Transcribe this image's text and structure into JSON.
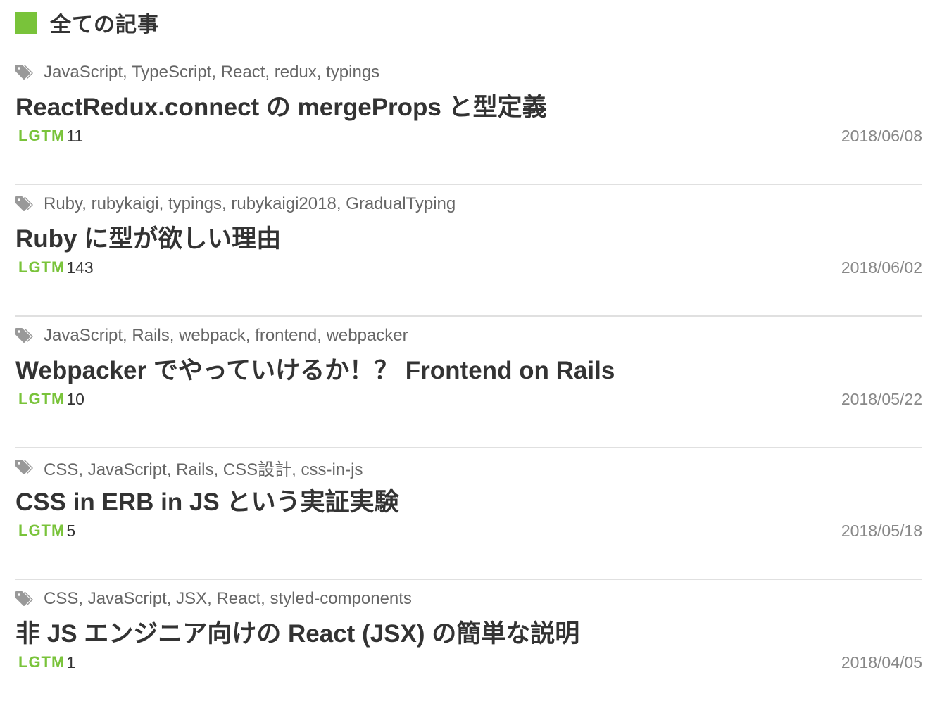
{
  "section": {
    "title": "全ての記事"
  },
  "colors": {
    "accent": "#79c33a",
    "tag_icon": "#999999",
    "divider": "#e0e0e0"
  },
  "icons": {
    "tag": "tags-icon"
  },
  "articles": [
    {
      "tags": [
        "JavaScript",
        "TypeScript",
        "React",
        "redux",
        "typings"
      ],
      "title": "ReactRedux.connect の mergeProps と型定義",
      "lgtm_label": "LGTM",
      "lgtm_count": "11",
      "date": "2018/06/08"
    },
    {
      "tags": [
        "Ruby",
        "rubykaigi",
        "typings",
        "rubykaigi2018",
        "GradualTyping"
      ],
      "title": "Ruby に型が欲しい理由",
      "lgtm_label": "LGTM",
      "lgtm_count": "143",
      "date": "2018/06/02"
    },
    {
      "tags": [
        "JavaScript",
        "Rails",
        "webpack",
        "frontend",
        "webpacker"
      ],
      "title": "Webpacker でやっていけるか！？ Frontend on Rails",
      "lgtm_label": "LGTM",
      "lgtm_count": "10",
      "date": "2018/05/22"
    },
    {
      "tags": [
        "CSS",
        "JavaScript",
        "Rails",
        "CSS設計",
        "css-in-js"
      ],
      "title": "CSS in ERB in JS という実証実験",
      "lgtm_label": "LGTM",
      "lgtm_count": "5",
      "date": "2018/05/18"
    },
    {
      "tags": [
        "CSS",
        "JavaScript",
        "JSX",
        "React",
        "styled-components"
      ],
      "title": "非 JS エンジニア向けの React (JSX) の簡単な説明",
      "lgtm_label": "LGTM",
      "lgtm_count": "1",
      "date": "2018/04/05"
    }
  ],
  "tag_separator": ",  "
}
